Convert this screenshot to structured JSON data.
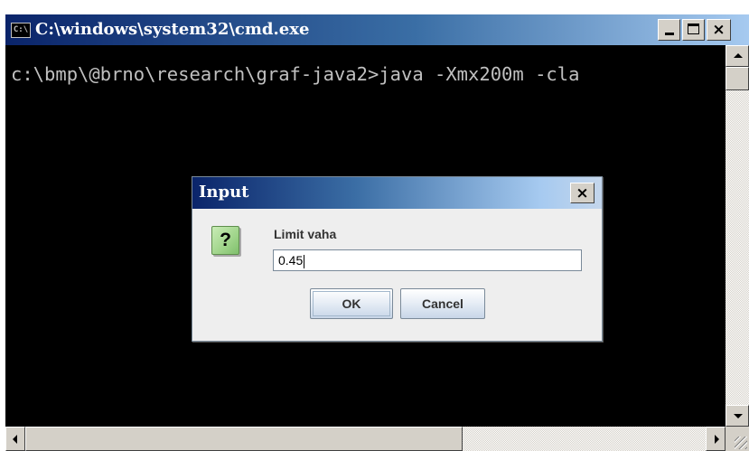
{
  "window": {
    "icon_text": "C:\\",
    "title": "C:\\windows\\system32\\cmd.exe",
    "controls": {
      "minimize": "_",
      "maximize": "□",
      "close": "×"
    }
  },
  "console": {
    "line1": "c:\\bmp\\@brno\\research\\graf-java2>java -Xmx200m -cla"
  },
  "dialog": {
    "title": "Input",
    "close": "×",
    "icon": "?",
    "label": "Limit vaha",
    "input_value": "0.45",
    "ok_label": "OK",
    "cancel_label": "Cancel"
  }
}
